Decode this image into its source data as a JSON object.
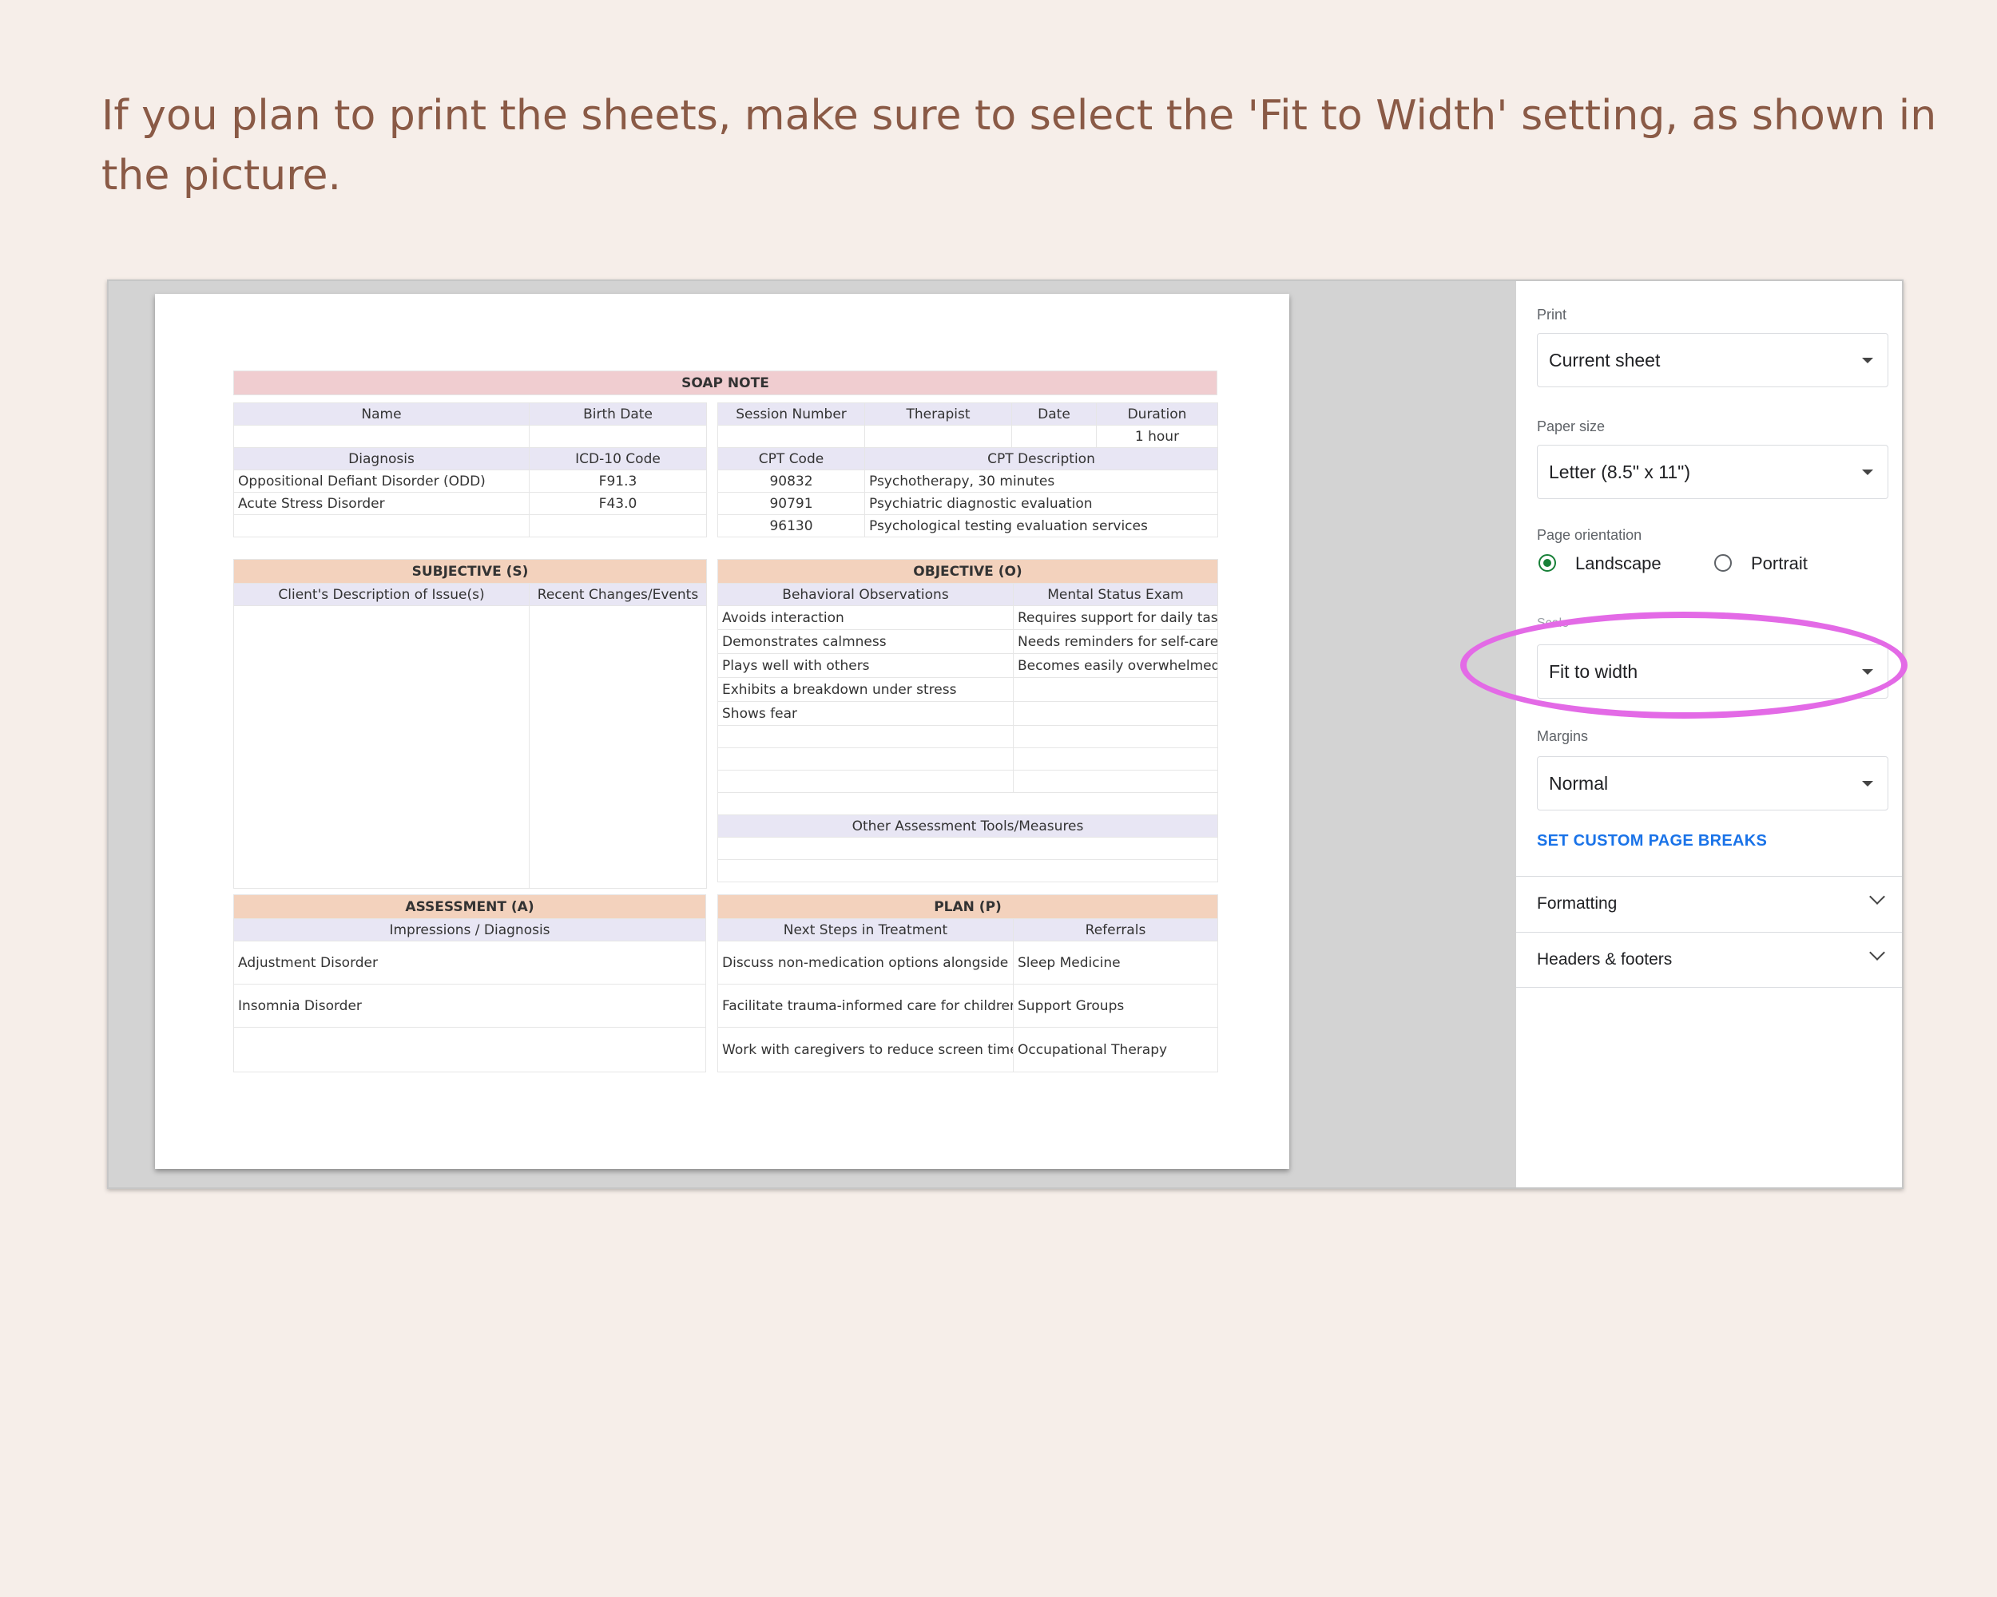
{
  "instruction": "If you plan to print the sheets, make sure to select the 'Fit to Width' setting, as shown in the picture.",
  "sheet": {
    "title": "SOAP NOTE",
    "info_headers": [
      "Name",
      "Birth Date",
      "Session Number",
      "Therapist",
      "Date",
      "Duration"
    ],
    "duration_value": "1 hour",
    "diag_headers": [
      "Diagnosis",
      "ICD-10 Code"
    ],
    "diagnoses": [
      {
        "name": "Oppositional Defiant Disorder (ODD)",
        "code": "F91.3"
      },
      {
        "name": "Acute Stress Disorder",
        "code": "F43.0"
      }
    ],
    "cpt_headers": [
      "CPT Code",
      "CPT Description"
    ],
    "cpt": [
      {
        "code": "90832",
        "desc": "Psychotherapy, 30 minutes"
      },
      {
        "code": "90791",
        "desc": "Psychiatric diagnostic evaluation"
      },
      {
        "code": "96130",
        "desc": "Psychological testing evaluation services"
      }
    ],
    "subjective": {
      "title": "SUBJECTIVE (S)",
      "col1": "Client's Description of Issue(s)",
      "col2": "Recent Changes/Events"
    },
    "objective": {
      "title": "OBJECTIVE (O)",
      "col1": "Behavioral Observations",
      "col2": "Mental Status Exam",
      "rows": [
        [
          "Avoids interaction",
          "Requires support for daily tasks"
        ],
        [
          "Demonstrates calmness",
          "Needs reminders for self-care"
        ],
        [
          "Plays well with others",
          "Becomes easily overwhelmed"
        ],
        [
          "Exhibits a breakdown under stress",
          ""
        ],
        [
          "Shows fear",
          ""
        ]
      ],
      "other_tools": "Other Assessment Tools/Measures"
    },
    "assessment": {
      "title": "ASSESSMENT (A)",
      "col": "Impressions / Diagnosis",
      "rows": [
        "Adjustment Disorder",
        "Insomnia Disorder"
      ]
    },
    "plan": {
      "title": "PLAN (P)",
      "col1": "Next Steps in Treatment",
      "col2": "Referrals",
      "rows": [
        [
          "Discuss non-medication options alongside therapy.",
          "Sleep Medicine"
        ],
        [
          "Facilitate trauma-informed care for children with a history of trauma.",
          "Support Groups"
        ],
        [
          "Work with caregivers to reduce screen time and encourage outdoor play.",
          "Occupational Therapy"
        ]
      ]
    }
  },
  "panel": {
    "print_label": "Print",
    "print_value": "Current sheet",
    "paper_label": "Paper size",
    "paper_value": "Letter (8.5\" x 11\")",
    "orientation_label": "Page orientation",
    "landscape": "Landscape",
    "portrait": "Portrait",
    "scale_label": "Scale",
    "scale_value": "Fit to width",
    "margins_label": "Margins",
    "margins_value": "Normal",
    "custom_breaks": "SET CUSTOM PAGE BREAKS",
    "formatting": "Formatting",
    "headers_footers": "Headers & footers"
  },
  "colors": {
    "highlight": "#e36ae6",
    "accent_green": "#188038",
    "link_blue": "#1a73e8",
    "header_pink": "#f0cdd0",
    "section_peach": "#f3d2bd",
    "header_lavender": "#e8e6f4"
  },
  "icons": [
    "dropdown-caret-icon",
    "chevron-down-icon",
    "radio-selected-icon",
    "radio-unselected-icon"
  ]
}
